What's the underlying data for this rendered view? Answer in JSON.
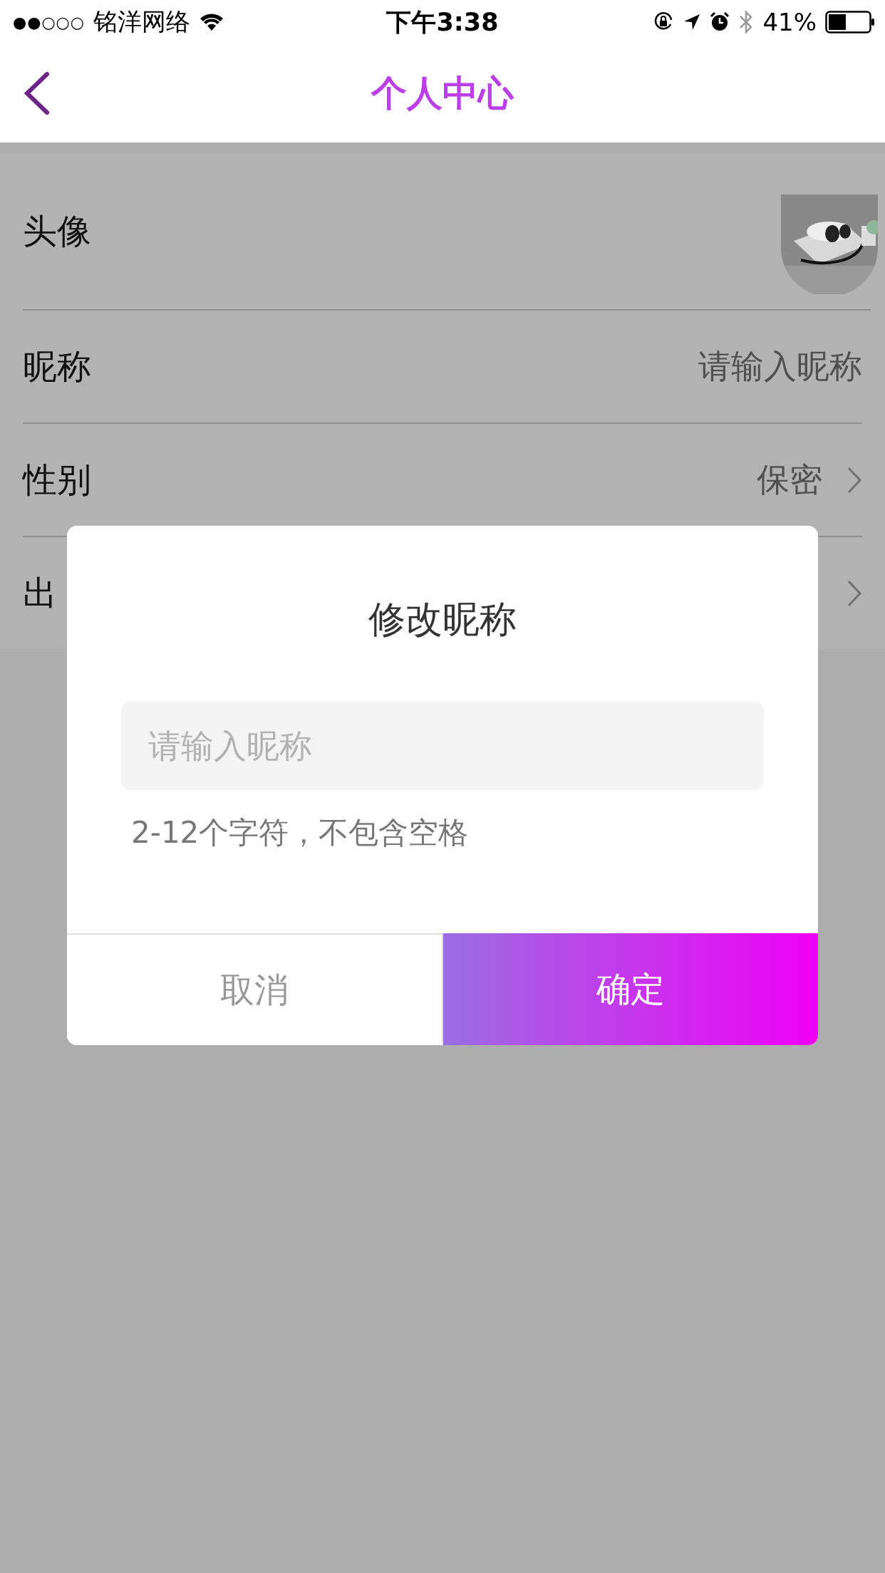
{
  "status_bar": {
    "signal": "●●○○○",
    "carrier": "铭洋网络",
    "time": "下午3:38",
    "battery": "41%"
  },
  "nav": {
    "title": "个人中心"
  },
  "rows": [
    {
      "kind": "avatar",
      "label": "头像"
    },
    {
      "kind": "text",
      "label": "昵称",
      "value": "请输入昵称"
    },
    {
      "kind": "select",
      "label": "性别",
      "value": "保密"
    },
    {
      "kind": "select",
      "label": "出"
    }
  ],
  "dialog": {
    "title": "修改昵称",
    "input": {
      "placeholder": "请输入昵称"
    },
    "hint": "2-12个字符，不包含空格",
    "buttons": [
      {
        "kind": "cancel",
        "label": "取消"
      },
      {
        "kind": "confirm",
        "label": "确定"
      }
    ]
  }
}
